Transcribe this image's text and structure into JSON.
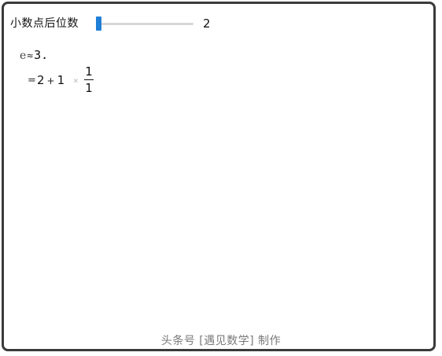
{
  "control": {
    "label": "小数点后位数",
    "value": "2",
    "slider_level": 0.0
  },
  "math": {
    "line1": {
      "e_symbol": "e",
      "approx_symbol": "≈",
      "value_text": "3."
    },
    "line2": {
      "eq_symbol": "=",
      "term1": "2",
      "plus": "+",
      "term2": "1",
      "times": "×",
      "frac_num": "1",
      "frac_den": "1"
    }
  },
  "footer": {
    "text": "头条号 [遇见数学] 制作"
  },
  "colors": {
    "accent": "#1f7ed6",
    "border": "#3a3a3a",
    "footer_text": "#7a7a7a"
  }
}
